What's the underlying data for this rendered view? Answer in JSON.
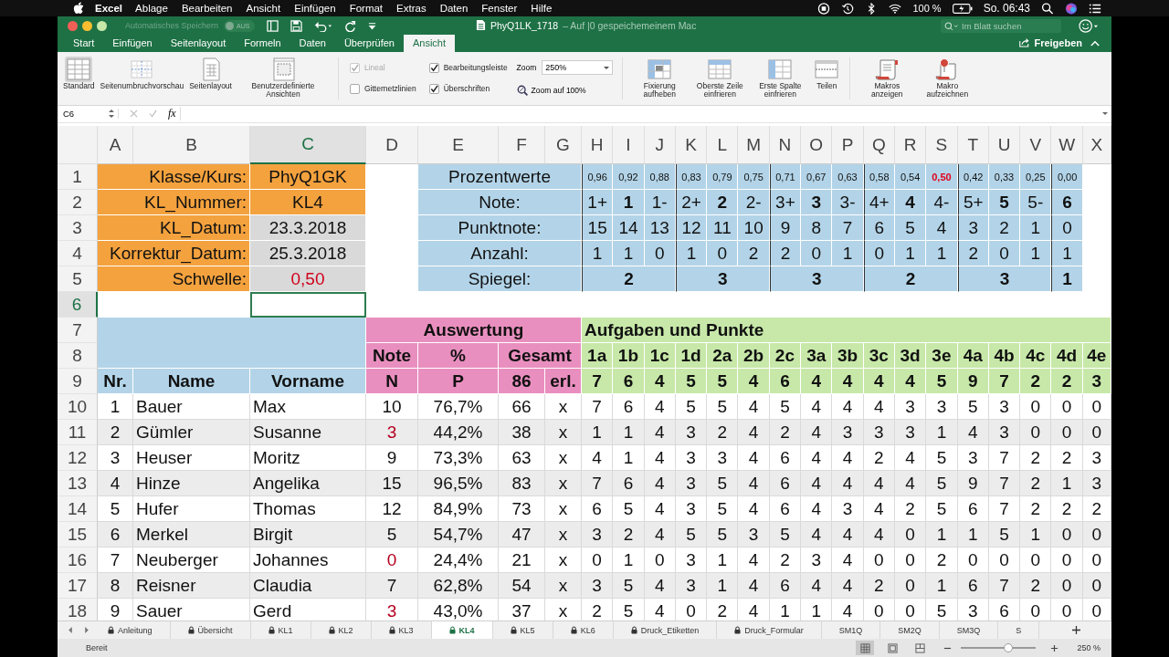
{
  "menu_bar": {
    "app": "Excel",
    "items": [
      "Ablage",
      "Bearbeiten",
      "Ansicht",
      "Einfügen",
      "Format",
      "Extras",
      "Daten",
      "Fenster",
      "Hilfe"
    ],
    "battery": "100 %",
    "clock": "So. 06:43"
  },
  "window": {
    "autosave_label": "Automatisches Speichern",
    "autosave_toggle": "AUS",
    "title": "PhyQ1LK_1718",
    "title_note": "– Auf |0 gespeichemeinem Mac",
    "search": {
      "placeholder": "Im Blatt suchen"
    }
  },
  "ribbon_tabs": [
    {
      "label": "Start",
      "selected": false
    },
    {
      "label": "Einfügen",
      "selected": false
    },
    {
      "label": "Seitenlayout",
      "selected": false
    },
    {
      "label": "Formeln",
      "selected": false
    },
    {
      "label": "Daten",
      "selected": false
    },
    {
      "label": "Überprüfen",
      "selected": false
    },
    {
      "label": "Ansicht",
      "selected": true
    }
  ],
  "share_button": "Freigeben",
  "ribbon": {
    "views": [
      {
        "label": "Standard",
        "kind": "normal",
        "selected": true
      },
      {
        "label": "Seitenumbruchvorschau",
        "kind": "page_break",
        "selected": false
      },
      {
        "label": "Seitenlayout",
        "kind": "page_layout",
        "selected": false
      },
      {
        "label": "Benutzerdefinierte Ansichten",
        "kind": "custom",
        "selected": false
      }
    ],
    "checkboxes": [
      {
        "label": "Lineal",
        "checked": true,
        "disabled": true
      },
      {
        "label": "Gitternetzlinien",
        "checked": false,
        "disabled": false
      },
      {
        "label": "Bearbeitungsleiste",
        "checked": true,
        "disabled": false
      },
      {
        "label": "Überschriften",
        "checked": true,
        "disabled": false
      }
    ],
    "zoom": {
      "label": "Zoom",
      "value": "250%",
      "reset": "Zoom auf 100%"
    },
    "window_buttons": [
      {
        "label": "Fixierung aufheben",
        "kind": "unfreeze"
      },
      {
        "label": "Oberste Zeile einfrieren",
        "kind": "freeze_row"
      },
      {
        "label": "Erste Spalte einfrieren",
        "kind": "freeze_column"
      },
      {
        "label": "Teilen",
        "kind": "split"
      }
    ],
    "macro_buttons": [
      {
        "label": "Makros anzeigen",
        "kind": "view"
      },
      {
        "label": "Makro aufzeichnen",
        "kind": "record"
      }
    ]
  },
  "formula_bar": {
    "name_box": "C6",
    "function_label": "fx"
  },
  "sheet": {
    "columns": [
      {
        "label": "A",
        "selected": false
      },
      {
        "label": "B",
        "selected": false
      },
      {
        "label": "C",
        "selected": true
      },
      {
        "label": "D",
        "selected": false
      },
      {
        "label": "E",
        "selected": false
      },
      {
        "label": "F",
        "selected": false
      },
      {
        "label": "G",
        "selected": false
      },
      {
        "label": "H",
        "selected": false
      },
      {
        "label": "I",
        "selected": false
      },
      {
        "label": "J",
        "selected": false
      },
      {
        "label": "K",
        "selected": false
      },
      {
        "label": "L",
        "selected": false
      },
      {
        "label": "M",
        "selected": false
      },
      {
        "label": "N",
        "selected": false
      },
      {
        "label": "O",
        "selected": false
      },
      {
        "label": "P",
        "selected": false
      },
      {
        "label": "Q",
        "selected": false
      },
      {
        "label": "R",
        "selected": false
      },
      {
        "label": "S",
        "selected": false
      },
      {
        "label": "T",
        "selected": false
      },
      {
        "label": "U",
        "selected": false
      },
      {
        "label": "V",
        "selected": false
      },
      {
        "label": "W",
        "selected": false
      },
      {
        "label": "X",
        "selected": false
      }
    ],
    "rows": [
      {
        "label": "1",
        "selected": false
      },
      {
        "label": "2",
        "selected": false
      },
      {
        "label": "3",
        "selected": false
      },
      {
        "label": "4",
        "selected": false
      },
      {
        "label": "5",
        "selected": false
      },
      {
        "label": "6",
        "selected": true
      },
      {
        "label": "7",
        "selected": false
      },
      {
        "label": "8",
        "selected": false
      },
      {
        "label": "9",
        "selected": false
      },
      {
        "label": "10",
        "selected": false
      },
      {
        "label": "11",
        "selected": false
      },
      {
        "label": "12",
        "selected": false
      },
      {
        "label": "13",
        "selected": false
      },
      {
        "label": "14",
        "selected": false
      },
      {
        "label": "15",
        "selected": false
      },
      {
        "label": "16",
        "selected": false
      },
      {
        "label": "17",
        "selected": false
      },
      {
        "label": "18",
        "selected": false
      }
    ],
    "info": [
      {
        "label": "Klasse/Kurs:",
        "value": "PhyQ1GK",
        "color": "#f4a23e",
        "warning": false
      },
      {
        "label": "KL_Nummer:",
        "value": "KL4",
        "color": "#f4a23e",
        "warning": false
      },
      {
        "label": "KL_Datum:",
        "value": "23.3.2018",
        "color": "#d9d9d9",
        "warning": false
      },
      {
        "label": "Korrektur_Datum:",
        "value": "25.3.2018",
        "color": "#d9d9d9",
        "warning": false
      },
      {
        "label": "Schwelle:",
        "value": "0,50",
        "color": "#d9d9d9",
        "warning": true
      }
    ],
    "grade_labels": [
      "Prozentwerte",
      "Note:",
      "Punktnote:",
      "Anzahl:",
      "Spiegel:"
    ],
    "grades": [
      {
        "percent": "0,96",
        "grade": "1+",
        "points": "15",
        "count": "1",
        "bold": false,
        "threshold": false
      },
      {
        "percent": "0,92",
        "grade": "1",
        "points": "14",
        "count": "1",
        "bold": true,
        "threshold": false
      },
      {
        "percent": "0,88",
        "grade": "1-",
        "points": "13",
        "count": "0",
        "bold": false,
        "threshold": false
      },
      {
        "percent": "0,83",
        "grade": "2+",
        "points": "12",
        "count": "1",
        "bold": false,
        "threshold": false
      },
      {
        "percent": "0,79",
        "grade": "2",
        "points": "11",
        "count": "0",
        "bold": true,
        "threshold": false
      },
      {
        "percent": "0,75",
        "grade": "2-",
        "points": "10",
        "count": "2",
        "bold": false,
        "threshold": false
      },
      {
        "percent": "0,71",
        "grade": "3+",
        "points": "9",
        "count": "2",
        "bold": false,
        "threshold": false
      },
      {
        "percent": "0,67",
        "grade": "3",
        "points": "8",
        "count": "0",
        "bold": true,
        "threshold": false
      },
      {
        "percent": "0,63",
        "grade": "3-",
        "points": "7",
        "count": "1",
        "bold": false,
        "threshold": false
      },
      {
        "percent": "0,58",
        "grade": "4+",
        "points": "6",
        "count": "0",
        "bold": false,
        "threshold": false
      },
      {
        "percent": "0,54",
        "grade": "4",
        "points": "5",
        "count": "1",
        "bold": true,
        "threshold": false
      },
      {
        "percent": "0,50",
        "grade": "4-",
        "points": "4",
        "count": "1",
        "bold": false,
        "threshold": true
      },
      {
        "percent": "0,42",
        "grade": "5+",
        "points": "3",
        "count": "2",
        "bold": false,
        "threshold": false
      },
      {
        "percent": "0,33",
        "grade": "5",
        "points": "2",
        "count": "0",
        "bold": true,
        "threshold": false
      },
      {
        "percent": "0,25",
        "grade": "5-",
        "points": "1",
        "count": "1",
        "bold": false,
        "threshold": false
      },
      {
        "percent": "0,00",
        "grade": "6",
        "points": "0",
        "count": "1",
        "bold": true,
        "threshold": false
      }
    ],
    "mirror": [
      "2",
      "3",
      "3",
      "2",
      "3",
      "1"
    ],
    "evaluation_title": "Auswertung",
    "evaluation_headers": [
      "Note",
      "%",
      "Gesamt"
    ],
    "evaluation_subheaders": [
      "N",
      "P",
      "86",
      "erl."
    ],
    "tasks_title": "Aufgaben und Punkte",
    "tasks": [
      {
        "label": "1a",
        "max": "7"
      },
      {
        "label": "1b",
        "max": "6"
      },
      {
        "label": "1c",
        "max": "4"
      },
      {
        "label": "1d",
        "max": "5"
      },
      {
        "label": "2a",
        "max": "5"
      },
      {
        "label": "2b",
        "max": "4"
      },
      {
        "label": "2c",
        "max": "6"
      },
      {
        "label": "3a",
        "max": "4"
      },
      {
        "label": "3b",
        "max": "4"
      },
      {
        "label": "3c",
        "max": "4"
      },
      {
        "label": "3d",
        "max": "4"
      },
      {
        "label": "3e",
        "max": "5"
      },
      {
        "label": "4a",
        "max": "9"
      },
      {
        "label": "4b",
        "max": "7"
      },
      {
        "label": "4c",
        "max": "2"
      },
      {
        "label": "4d",
        "max": "2"
      },
      {
        "label": "4e",
        "max": "3"
      }
    ],
    "roster_headers": [
      "Nr.",
      "Name",
      "Vorname"
    ],
    "students": [
      {
        "nr": "1",
        "name": "Bauer",
        "first_name": "Max",
        "note": "10",
        "failing": false,
        "percent": "76,7%",
        "total": "66",
        "done": "x",
        "points": [
          "7",
          "6",
          "4",
          "5",
          "5",
          "4",
          "5",
          "4",
          "4",
          "4",
          "3",
          "3",
          "5",
          "3",
          "0",
          "0",
          "0"
        ]
      },
      {
        "nr": "2",
        "name": "Gümler",
        "first_name": "Susanne",
        "note": "3",
        "failing": true,
        "percent": "44,2%",
        "total": "38",
        "done": "x",
        "points": [
          "1",
          "1",
          "4",
          "3",
          "2",
          "4",
          "2",
          "4",
          "3",
          "3",
          "3",
          "1",
          "4",
          "3",
          "0",
          "0",
          "0"
        ]
      },
      {
        "nr": "3",
        "name": "Heuser",
        "first_name": "Moritz",
        "note": "9",
        "failing": false,
        "percent": "73,3%",
        "total": "63",
        "done": "x",
        "points": [
          "4",
          "1",
          "4",
          "3",
          "3",
          "4",
          "6",
          "4",
          "4",
          "2",
          "4",
          "5",
          "3",
          "7",
          "2",
          "2",
          "3"
        ]
      },
      {
        "nr": "4",
        "name": "Hinze",
        "first_name": "Angelika",
        "note": "15",
        "failing": false,
        "percent": "96,5%",
        "total": "83",
        "done": "x",
        "points": [
          "7",
          "6",
          "4",
          "3",
          "5",
          "4",
          "6",
          "4",
          "4",
          "4",
          "4",
          "5",
          "9",
          "7",
          "2",
          "1",
          "3"
        ]
      },
      {
        "nr": "5",
        "name": "Hufer",
        "first_name": "Thomas",
        "note": "12",
        "failing": false,
        "percent": "84,9%",
        "total": "73",
        "done": "x",
        "points": [
          "6",
          "5",
          "4",
          "3",
          "5",
          "4",
          "6",
          "4",
          "3",
          "4",
          "2",
          "5",
          "6",
          "7",
          "2",
          "2",
          "2"
        ]
      },
      {
        "nr": "6",
        "name": "Merkel",
        "first_name": "Birgit",
        "note": "5",
        "failing": false,
        "percent": "54,7%",
        "total": "47",
        "done": "x",
        "points": [
          "3",
          "2",
          "4",
          "5",
          "5",
          "3",
          "5",
          "4",
          "4",
          "4",
          "0",
          "1",
          "1",
          "5",
          "1",
          "0",
          "0"
        ]
      },
      {
        "nr": "7",
        "name": "Neuberger",
        "first_name": "Johannes",
        "note": "0",
        "failing": true,
        "percent": "24,4%",
        "total": "21",
        "done": "x",
        "points": [
          "0",
          "1",
          "0",
          "3",
          "1",
          "4",
          "2",
          "3",
          "4",
          "0",
          "0",
          "2",
          "0",
          "0",
          "0",
          "0",
          "0"
        ]
      },
      {
        "nr": "8",
        "name": "Reisner",
        "first_name": "Claudia",
        "note": "7",
        "failing": false,
        "percent": "62,8%",
        "total": "54",
        "done": "x",
        "points": [
          "3",
          "5",
          "4",
          "3",
          "1",
          "4",
          "6",
          "4",
          "4",
          "2",
          "0",
          "1",
          "6",
          "7",
          "2",
          "0",
          "0"
        ]
      },
      {
        "nr": "9",
        "name": "Sauer",
        "first_name": "Gerd",
        "note": "3",
        "failing": true,
        "percent": "43,0%",
        "total": "37",
        "done": "x",
        "points": [
          "2",
          "5",
          "4",
          "0",
          "2",
          "4",
          "1",
          "1",
          "4",
          "0",
          "0",
          "5",
          "3",
          "6",
          "0",
          "0",
          "0"
        ]
      }
    ]
  },
  "sheet_tabs": [
    {
      "label": "Anleitung",
      "locked": true,
      "selected": false
    },
    {
      "label": "Übersicht",
      "locked": true,
      "selected": false
    },
    {
      "label": "KL1",
      "locked": true,
      "selected": false
    },
    {
      "label": "KL2",
      "locked": true,
      "selected": false
    },
    {
      "label": "KL3",
      "locked": true,
      "selected": false
    },
    {
      "label": "KL4",
      "locked": true,
      "selected": true
    },
    {
      "label": "KL5",
      "locked": true,
      "selected": false
    },
    {
      "label": "KL6",
      "locked": true,
      "selected": false
    },
    {
      "label": "Druck_Etiketten",
      "locked": true,
      "selected": false
    },
    {
      "label": "Druck_Formular",
      "locked": true,
      "selected": false
    },
    {
      "label": "SM1Q",
      "locked": false,
      "selected": false
    },
    {
      "label": "SM2Q",
      "locked": false,
      "selected": false
    },
    {
      "label": "SM3Q",
      "locked": false,
      "selected": false
    },
    {
      "label": "S",
      "locked": false,
      "selected": false
    }
  ],
  "status_bar": {
    "text": "Bereit",
    "views": [
      {
        "kind": "normal",
        "selected": true
      },
      {
        "kind": "page_layout",
        "selected": false
      },
      {
        "kind": "page_break",
        "selected": false
      }
    ],
    "zoom": {
      "level": 0.63,
      "reading": "250 %"
    }
  }
}
